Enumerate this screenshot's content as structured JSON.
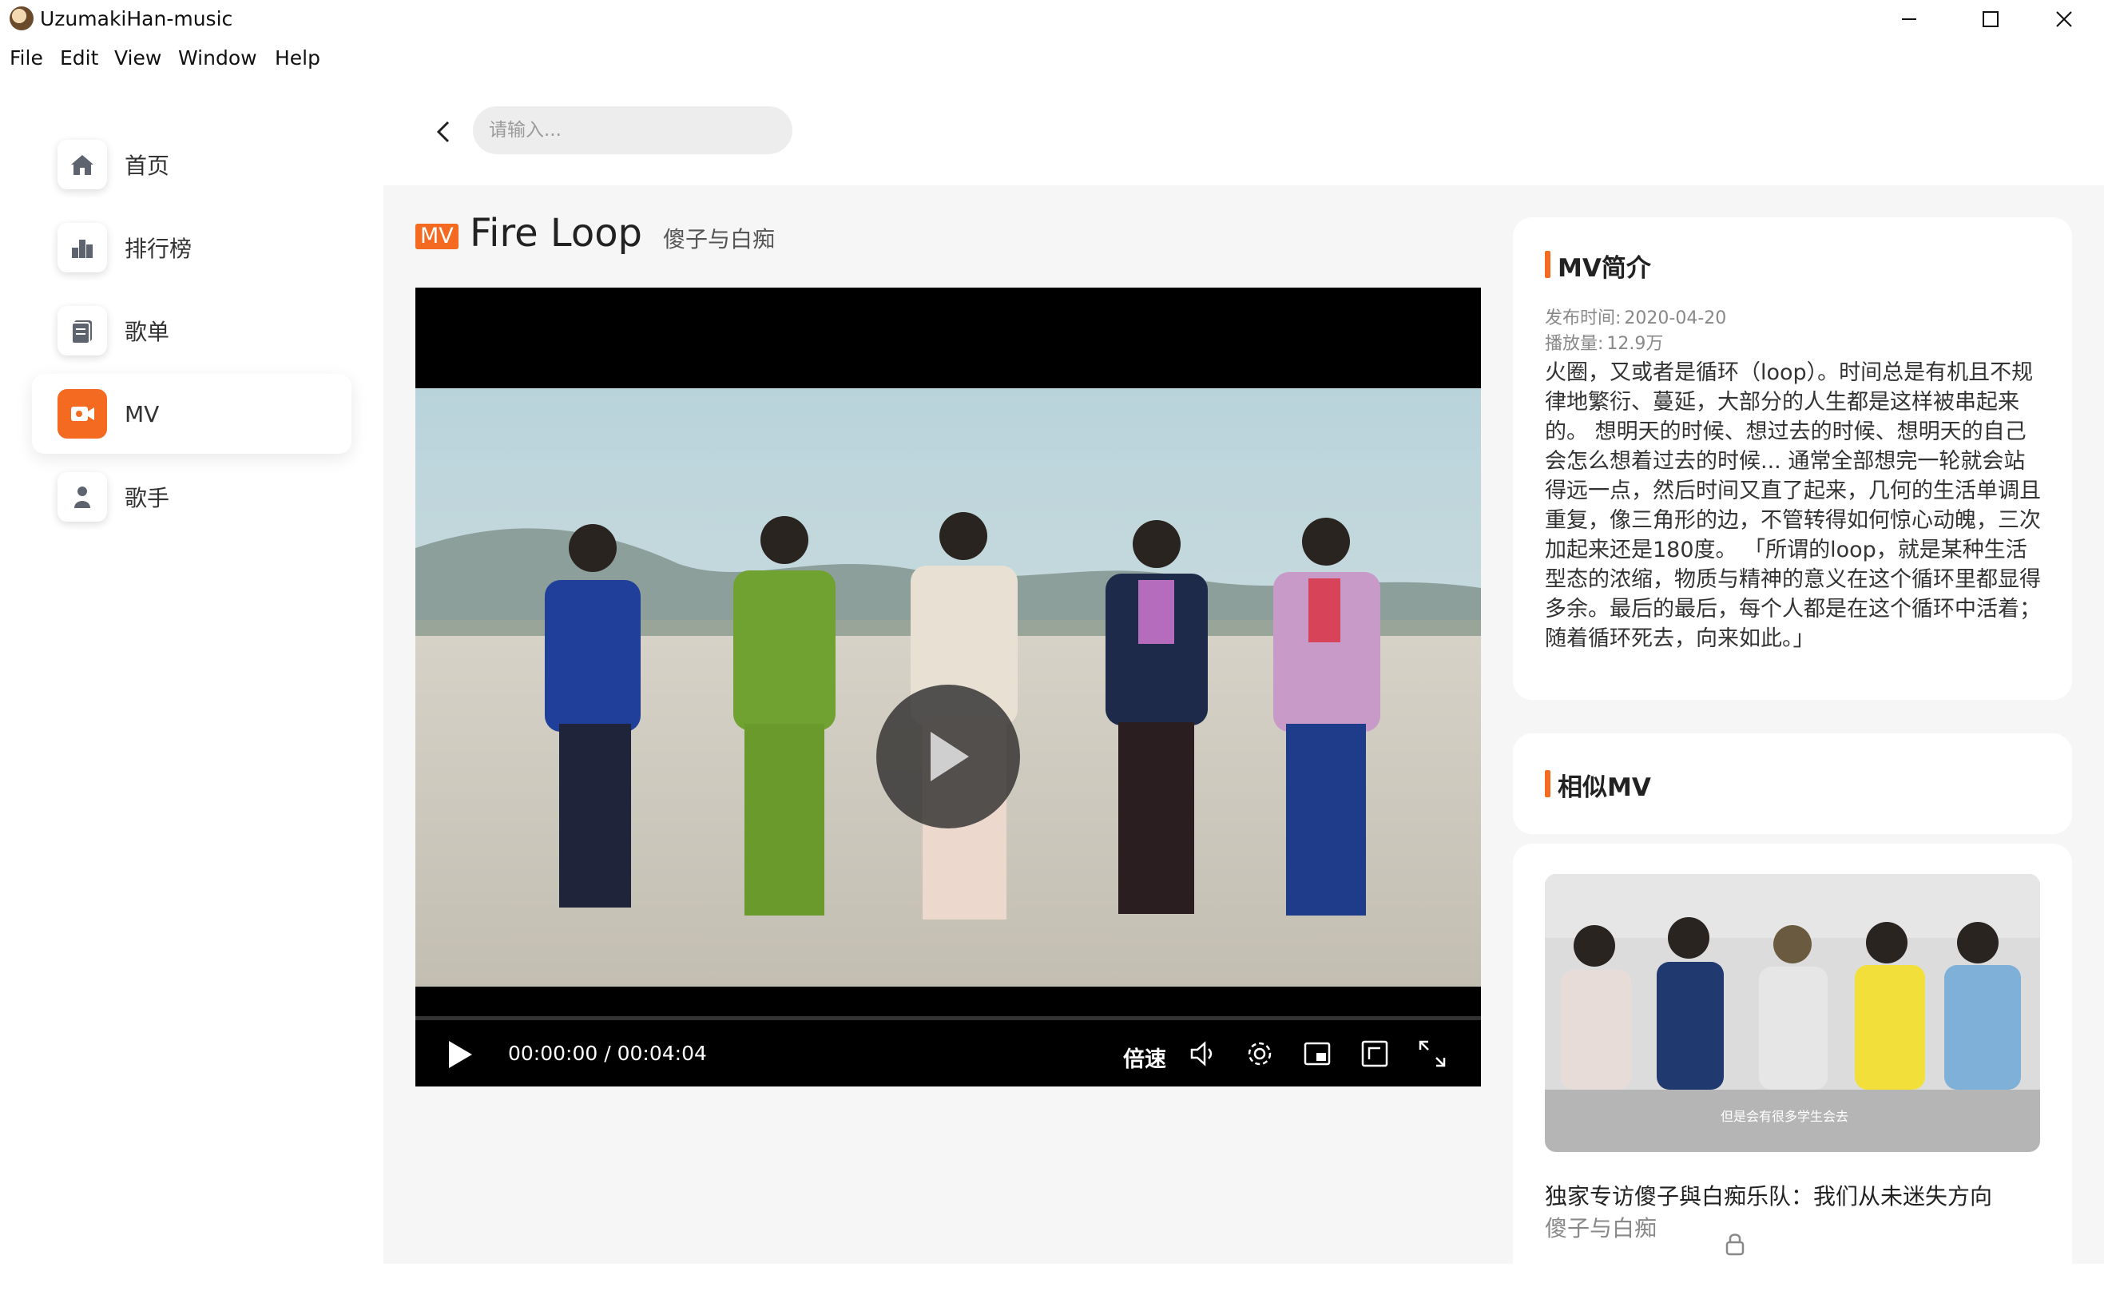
{
  "window": {
    "title": "UzumakiHan-music",
    "menu": [
      "File",
      "Edit",
      "View",
      "Window",
      "Help"
    ]
  },
  "sidebar": {
    "items": [
      {
        "label": "首页",
        "icon": "home-icon",
        "active": false
      },
      {
        "label": "排行榜",
        "icon": "chart-icon",
        "active": false
      },
      {
        "label": "歌单",
        "icon": "playlist-icon",
        "active": false
      },
      {
        "label": "MV",
        "icon": "video-camera-icon",
        "active": true
      },
      {
        "label": "歌手",
        "icon": "singer-icon",
        "active": false
      }
    ]
  },
  "search": {
    "placeholder": "请输入...",
    "value": ""
  },
  "mv": {
    "badge": "MV",
    "title": "Fire Loop",
    "artist": "傻子与白痴"
  },
  "player": {
    "current_time": "00:00:00",
    "separator": " / ",
    "duration": "00:04:04",
    "progress": 0,
    "speed_label": "倍速"
  },
  "intro": {
    "title": "MV简介",
    "publish_label": "发布时间:",
    "publish_date": "2020-04-20",
    "plays_label": "播放量:",
    "plays": "12.9万",
    "description": "火圈，又或者是循环（loop）。时间总是有机且不规律地繁衍、蔓延，大部分的人生都是这样被串起来的。 想明天的时候、想过去的时候、想明天的自己会怎么想着过去的时候... 通常全部想完一轮就会站得远一点，然后时间又直了起来，几何的生活单调且重复，像三角形的边，不管转得如何惊心动魄，三次加起来还是180度。 「所谓的loop，就是某种生活型态的浓缩，物质与精神的意义在这个循环里都显得多余。最后的最后，每个人都是在这个循环中活着；随着循环死去，向来如此。」"
  },
  "similar": {
    "title": "相似MV",
    "items": [
      {
        "title": "独家专访傻子與白痴乐队：我们从未迷失方向",
        "artist": "傻子与白痴",
        "thumb_subtitle": "但是会有很多学生会去"
      }
    ]
  },
  "colors": {
    "accent": "#f46a21",
    "bg": "#f6f6f6"
  }
}
